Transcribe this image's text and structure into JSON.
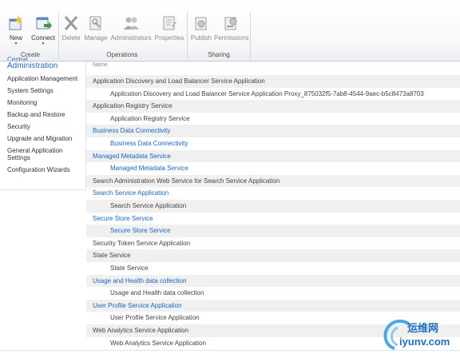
{
  "ribbon": {
    "buttons": {
      "new": "New",
      "connect": "Connect",
      "delete": "Delete",
      "manage": "Manage",
      "administrators": "Administrators",
      "properties": "Properties",
      "publish": "Publish",
      "permissions": "Permissions"
    },
    "groups": {
      "create": "Create",
      "operations": "Operations",
      "sharing": "Sharing"
    }
  },
  "leftnav": {
    "title": "Central Administration",
    "title_line1": "Central",
    "title_line2": "Administration",
    "items": [
      "Application Management",
      "System Settings",
      "Monitoring",
      "Backup and Restore",
      "Security",
      "Upgrade and Migration",
      "General Application Settings",
      "Configuration Wizards"
    ]
  },
  "list": {
    "column_header": "Name",
    "rows": [
      {
        "text": "Application Discovery and Load Balancer Service Application",
        "level": 0,
        "link": false
      },
      {
        "text": "Application Discovery and Load Balancer Service Application Proxy_875032f5-7ab8-4544-9aec-b5c8473a8703",
        "level": 1,
        "link": false
      },
      {
        "text": "Application Registry Service",
        "level": 0,
        "link": false
      },
      {
        "text": "Application Registry Service",
        "level": 1,
        "link": false
      },
      {
        "text": "Business Data Connectivity",
        "level": 0,
        "link": true
      },
      {
        "text": "Business Data Connectivity",
        "level": 1,
        "link": true
      },
      {
        "text": "Managed Metadata Service",
        "level": 0,
        "link": true
      },
      {
        "text": "Managed Metadata Service",
        "level": 1,
        "link": true
      },
      {
        "text": "Search Administration Web Service for Search Service Application",
        "level": 0,
        "link": false
      },
      {
        "text": "Search Service Application",
        "level": 0,
        "link": true
      },
      {
        "text": "Search Service Application",
        "level": 1,
        "link": false
      },
      {
        "text": "Secure Store Service",
        "level": 0,
        "link": true
      },
      {
        "text": "Secure Store Service",
        "level": 1,
        "link": true
      },
      {
        "text": "Security Token Service Application",
        "level": 0,
        "link": false
      },
      {
        "text": "State Service",
        "level": 0,
        "link": false
      },
      {
        "text": "State Service",
        "level": 1,
        "link": false
      },
      {
        "text": "Usage and Health data collection",
        "level": 0,
        "link": true
      },
      {
        "text": "Usage and Health data collection",
        "level": 1,
        "link": false
      },
      {
        "text": "User Profile Service Application",
        "level": 0,
        "link": true
      },
      {
        "text": "User Profile Service Application",
        "level": 1,
        "link": false
      },
      {
        "text": "Web Analytics Service Application",
        "level": 0,
        "link": false
      },
      {
        "text": "Web Analytics Service Application",
        "level": 1,
        "link": false
      }
    ]
  },
  "watermark": {
    "line1": "运维网",
    "line2": "iyunv.com"
  },
  "colors": {
    "link": "#1a65c0",
    "nav_title": "#2d6ab5",
    "alt_row": "#f0f0f0"
  }
}
